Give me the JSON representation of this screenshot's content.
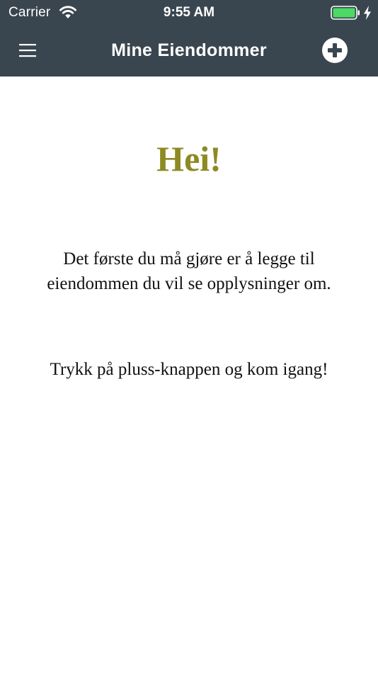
{
  "status_bar": {
    "carrier": "Carrier",
    "time": "9:55 AM",
    "battery_color": "#4cd964"
  },
  "nav": {
    "title": "Mine Eiendommer",
    "menu_icon": "hamburger-menu-icon",
    "add_icon": "plus-circle-icon",
    "background": "#3a464f"
  },
  "content": {
    "greeting": "Hei!",
    "greeting_color": "#8d8a24",
    "intro": "Det første du må gjøre er å legge til eiendommen du vil se opplysninger om.",
    "cta": "Trykk på pluss-knappen og kom igang!"
  }
}
